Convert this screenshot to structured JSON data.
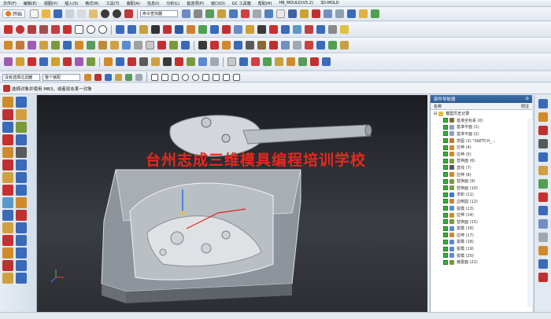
{
  "menubar": {
    "items": [
      "文件(F)",
      "编辑(E)",
      "视图(V)",
      "插入(S)",
      "格式(R)",
      "工具(T)",
      "装配(A)",
      "信息(I)",
      "分析(L)",
      "首选项(P)",
      "窗口(O)",
      "GC 工具箱",
      "帮助(H)",
      "HB_MOULD(V5.2)",
      "3D-MOLD"
    ]
  },
  "toolbar1": {
    "start_label": "开始",
    "command_finder": "命令查找器"
  },
  "selection_bar": {
    "filter_value": "没有选择过滤器",
    "scope_value": "整个装配"
  },
  "prompt": {
    "message": "选择对象并使用 MB3，或者双击某一对象"
  },
  "viewport": {
    "watermark": "台州志成三维模具编程培训学校"
  },
  "part_navigator": {
    "title": "部件导航器",
    "col_name": "名称",
    "col_attach": "附注",
    "root": "模型历史记录",
    "items": [
      {
        "label": "基准坐标系 (0)",
        "icon": "datum-csys-icon",
        "color": "#8a6a2f"
      },
      {
        "label": "基准平面 (1)",
        "icon": "datum-plane-icon",
        "color": "#8aa0c0"
      },
      {
        "label": "基准平面 (2)",
        "icon": "datum-plane-icon",
        "color": "#8aa0c0"
      },
      {
        "label": "草图 (3) \"SKETCH_...",
        "icon": "sketch-icon",
        "color": "#c07a2f"
      },
      {
        "label": "拉伸 (4)",
        "icon": "extrude-icon",
        "color": "#d08a2a"
      },
      {
        "label": "拉伸 (5)",
        "icon": "extrude-icon",
        "color": "#d08a2a"
      },
      {
        "label": "替换面 (6)",
        "icon": "replace-face-icon",
        "color": "#7a9a3a"
      },
      {
        "label": "直线 (7)",
        "icon": "line-icon",
        "color": "#555555"
      },
      {
        "label": "拉伸 (8)",
        "icon": "extrude-icon",
        "color": "#d08a2a"
      },
      {
        "label": "替换面 (9)",
        "icon": "replace-face-icon",
        "color": "#7a9a3a"
      },
      {
        "label": "替换面 (10)",
        "icon": "replace-face-icon",
        "color": "#7a9a3a"
      },
      {
        "label": "求和 (11)",
        "icon": "unite-icon",
        "color": "#3a7ad0"
      },
      {
        "label": "边倒圆 (12)",
        "icon": "edge-blend-icon",
        "color": "#c08a3a"
      },
      {
        "label": "拔模 (13)",
        "icon": "draft-icon",
        "color": "#5a8ad0"
      },
      {
        "label": "拉伸 (14)",
        "icon": "extrude-icon",
        "color": "#d08a2a"
      },
      {
        "label": "替换面 (15)",
        "icon": "replace-face-icon",
        "color": "#7a9a3a"
      },
      {
        "label": "拔模 (16)",
        "icon": "draft-icon",
        "color": "#5a8ad0"
      },
      {
        "label": "拉伸 (17)",
        "icon": "extrude-icon",
        "color": "#d08a2a"
      },
      {
        "label": "拔模 (18)",
        "icon": "draft-icon",
        "color": "#5a8ad0"
      },
      {
        "label": "拔模 (19)",
        "icon": "draft-icon",
        "color": "#5a8ad0"
      },
      {
        "label": "拔模 (20)",
        "icon": "draft-icon",
        "color": "#5a8ad0"
      },
      {
        "label": "偏置面 (21)",
        "icon": "offset-face-icon",
        "color": "#7a9a3a"
      }
    ]
  }
}
